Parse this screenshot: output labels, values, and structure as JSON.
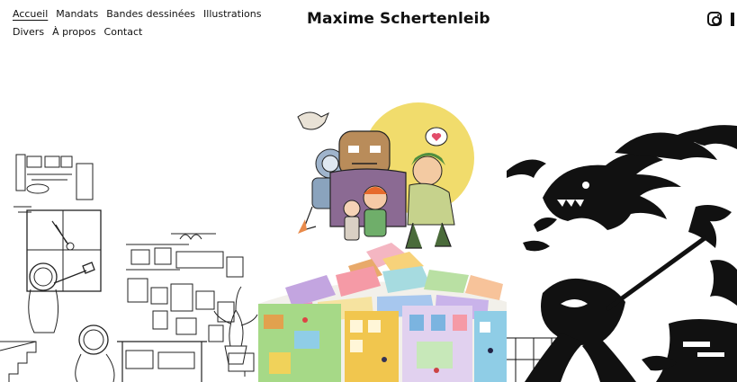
{
  "header": {
    "site_title": "Maxime Schertenleib",
    "nav": {
      "row1": [
        "Accueil",
        "Mandats",
        "Bandes dessinées",
        "Illustrations"
      ],
      "row2": [
        "Divers",
        "À propos",
        "Contact"
      ],
      "active": "Accueil"
    },
    "social": {
      "icon": "instagram-icon"
    }
  },
  "gallery": {
    "panels": [
      {
        "id": "astronaut-room",
        "style": "black-and-white line art"
      },
      {
        "id": "characters-map",
        "style": "color"
      },
      {
        "id": "dragon-warrior",
        "style": "black-and-white ink"
      }
    ]
  },
  "colors": {
    "text": "#111111",
    "background": "#ffffff",
    "sun": "#f1dc6c"
  }
}
